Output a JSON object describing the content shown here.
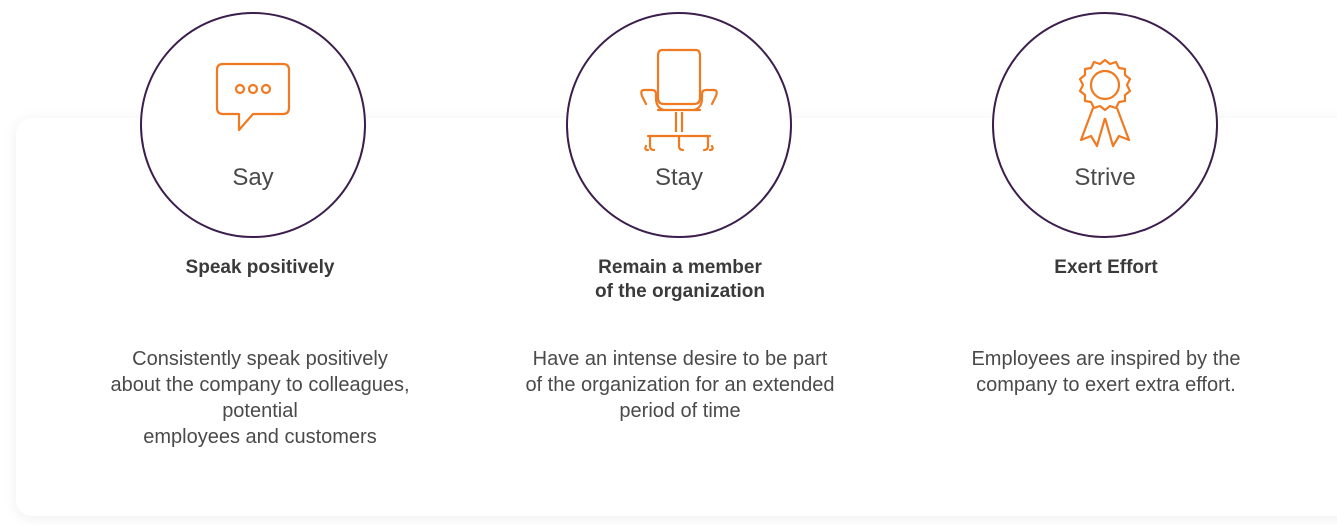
{
  "pillars": [
    {
      "label": "Say",
      "icon": "speech-bubble-icon",
      "heading": "Speak positively",
      "description": "Consistently speak positively\nabout the company to colleagues,\npotential\nemployees and customers"
    },
    {
      "label": "Stay",
      "icon": "office-chair-icon",
      "heading": "Remain a member\nof the organization",
      "description": "Have an intense desire to be part\nof  the organization for an extended\nperiod of time"
    },
    {
      "label": "Strive",
      "icon": "award-ribbon-icon",
      "heading": "Exert Effort",
      "description": "Employees are inspired by the\ncompany to exert extra effort."
    }
  ],
  "colors": {
    "circle_border": "#3c1e4d",
    "icon_accent": "#f07a22",
    "text": "#4a4a4a"
  }
}
